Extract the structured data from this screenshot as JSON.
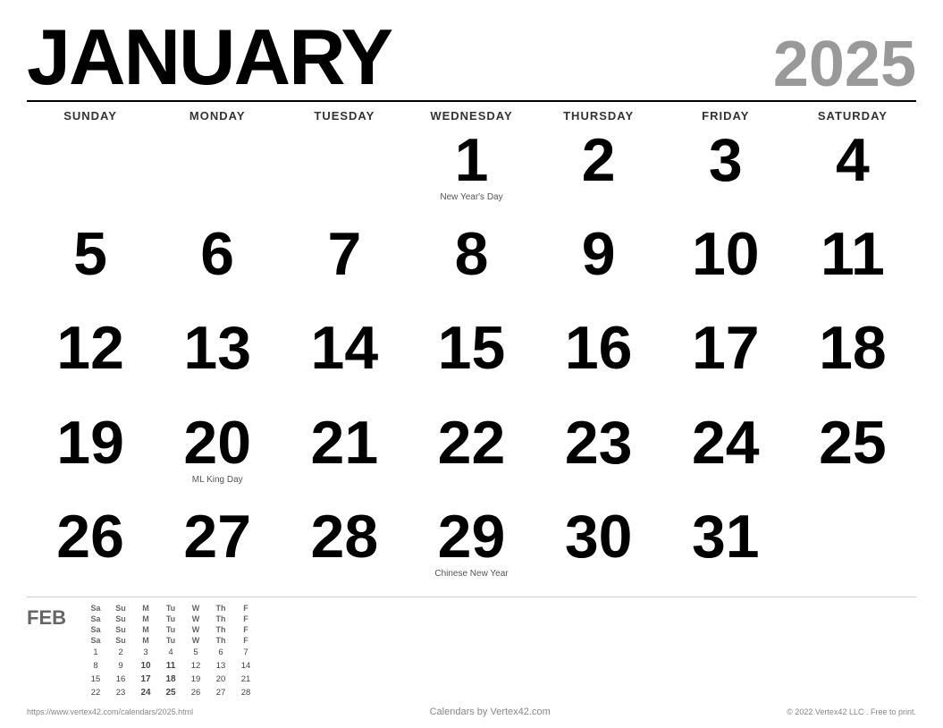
{
  "header": {
    "month": "JANUARY",
    "year": "2025"
  },
  "days_of_week": [
    "SUNDAY",
    "MONDAY",
    "TUESDAY",
    "WEDNESDAY",
    "THURSDAY",
    "FRIDAY",
    "SATURDAY"
  ],
  "weeks": [
    [
      {
        "day": "",
        "holiday": ""
      },
      {
        "day": "",
        "holiday": ""
      },
      {
        "day": "",
        "holiday": ""
      },
      {
        "day": "1",
        "holiday": "New Year's Day"
      },
      {
        "day": "2",
        "holiday": ""
      },
      {
        "day": "3",
        "holiday": ""
      },
      {
        "day": "4",
        "holiday": ""
      }
    ],
    [
      {
        "day": "5",
        "holiday": ""
      },
      {
        "day": "6",
        "holiday": ""
      },
      {
        "day": "7",
        "holiday": ""
      },
      {
        "day": "8",
        "holiday": ""
      },
      {
        "day": "9",
        "holiday": ""
      },
      {
        "day": "10",
        "holiday": ""
      },
      {
        "day": "11",
        "holiday": ""
      }
    ],
    [
      {
        "day": "12",
        "holiday": ""
      },
      {
        "day": "13",
        "holiday": ""
      },
      {
        "day": "14",
        "holiday": ""
      },
      {
        "day": "15",
        "holiday": ""
      },
      {
        "day": "16",
        "holiday": ""
      },
      {
        "day": "17",
        "holiday": ""
      },
      {
        "day": "18",
        "holiday": ""
      }
    ],
    [
      {
        "day": "19",
        "holiday": ""
      },
      {
        "day": "20",
        "holiday": "ML King Day"
      },
      {
        "day": "21",
        "holiday": ""
      },
      {
        "day": "22",
        "holiday": ""
      },
      {
        "day": "23",
        "holiday": ""
      },
      {
        "day": "24",
        "holiday": ""
      },
      {
        "day": "25",
        "holiday": ""
      }
    ],
    [
      {
        "day": "26",
        "holiday": ""
      },
      {
        "day": "27",
        "holiday": ""
      },
      {
        "day": "28",
        "holiday": ""
      },
      {
        "day": "29",
        "holiday": "Chinese New Year"
      },
      {
        "day": "30",
        "holiday": ""
      },
      {
        "day": "31",
        "holiday": ""
      },
      {
        "day": "",
        "holiday": ""
      }
    ]
  ],
  "mini_cal": {
    "month_label": "FEB",
    "day_names": [
      "Sa",
      "Su",
      "M",
      "Tu",
      "W",
      "Th",
      "F",
      "Sa",
      "Su",
      "M",
      "Tu",
      "W",
      "Th",
      "F",
      "Sa",
      "Su",
      "M",
      "Tu",
      "W",
      "Th",
      "F",
      "Sa",
      "Su",
      "M",
      "Tu",
      "W",
      "Th",
      "F"
    ],
    "day_values": [
      "1",
      "2",
      "3",
      "4",
      "5",
      "6",
      "7",
      "8",
      "9",
      "10",
      "11",
      "12",
      "13",
      "14",
      "15",
      "16",
      "17",
      "18",
      "19",
      "20",
      "21",
      "22",
      "23",
      "24",
      "25",
      "26",
      "27",
      "28"
    ],
    "bold_days": [
      "10",
      "11",
      "17",
      "18",
      "24",
      "25"
    ]
  },
  "footer": {
    "url": "https://www.vertex42.com/calendars/2025.html",
    "center": "Calendars by Vertex42.com",
    "copyright": "© 2022 Vertex42 LLC . Free to print."
  }
}
